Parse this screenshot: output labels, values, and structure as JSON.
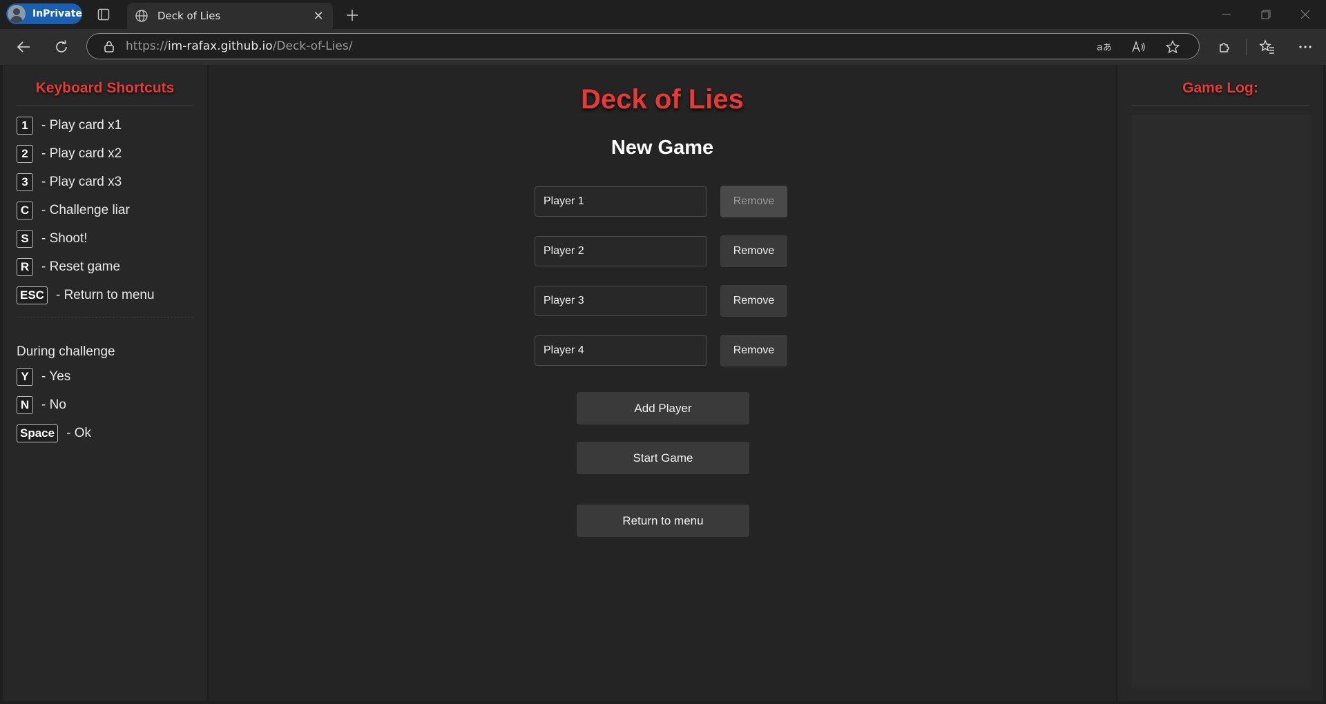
{
  "browser": {
    "inprivate_label": "InPrivate",
    "tab_title": "Deck of Lies",
    "url_scheme": "https://",
    "url_host": "im-rafax.github.io",
    "url_path": "/Deck-of-Lies/"
  },
  "shortcuts": {
    "title": "Keyboard Shortcuts",
    "items": [
      {
        "key": "1",
        "label": "- Play card x1"
      },
      {
        "key": "2",
        "label": "- Play card x2"
      },
      {
        "key": "3",
        "label": "- Play card x3"
      },
      {
        "key": "C",
        "label": "- Challenge liar"
      },
      {
        "key": "S",
        "label": "- Shoot!"
      },
      {
        "key": "R",
        "label": "- Reset game"
      },
      {
        "key": "ESC",
        "label": "- Return to menu"
      }
    ],
    "challenge_heading": "During challenge",
    "challenge_items": [
      {
        "key": "Y",
        "label": "- Yes"
      },
      {
        "key": "N",
        "label": "- No"
      },
      {
        "key": "Space",
        "label": "- Ok"
      }
    ]
  },
  "game": {
    "title": "Deck of Lies",
    "subtitle": "New Game",
    "players": [
      {
        "value": "Player 1",
        "remove_label": "Remove",
        "remove_disabled": true
      },
      {
        "value": "Player 2",
        "remove_label": "Remove",
        "remove_disabled": false
      },
      {
        "value": "Player 3",
        "remove_label": "Remove",
        "remove_disabled": false
      },
      {
        "value": "Player 4",
        "remove_label": "Remove",
        "remove_disabled": false
      }
    ],
    "add_player_label": "Add Player",
    "start_game_label": "Start Game",
    "return_menu_label": "Return to menu"
  },
  "log": {
    "title": "Game Log:"
  },
  "colors": {
    "accent": "#e53a35",
    "background": "#242424",
    "button": "#3a3a3a"
  }
}
